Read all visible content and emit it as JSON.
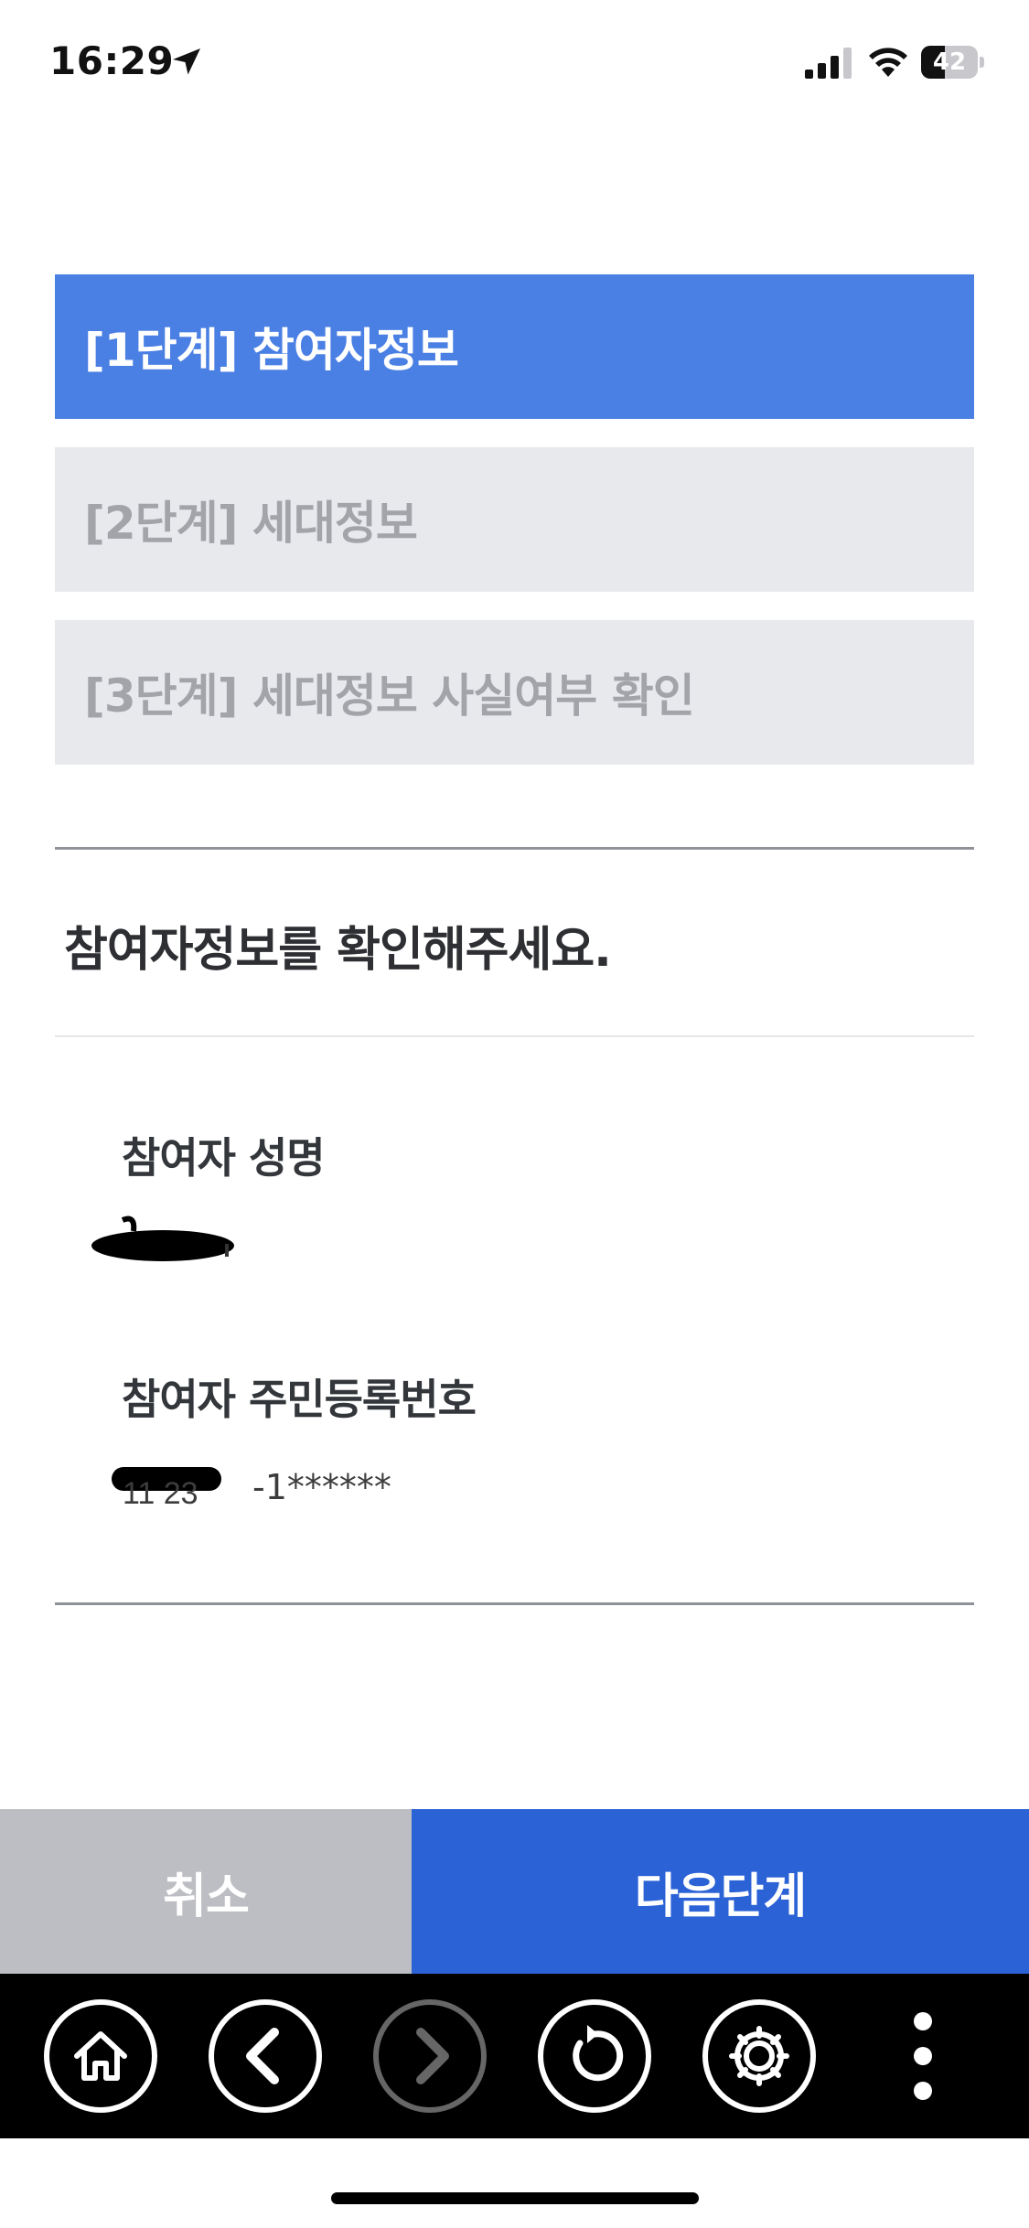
{
  "status_bar": {
    "time": "16:29",
    "battery_level": "42",
    "icons": [
      "location-arrow-icon",
      "cell-signal-icon",
      "wifi-icon",
      "battery-icon"
    ]
  },
  "steps": [
    {
      "label": "[1단계] 참여자정보",
      "active": true
    },
    {
      "label": "[2단계] 세대정보",
      "active": false
    },
    {
      "label": "[3단계] 세대정보 사실여부 확인",
      "active": false
    }
  ],
  "section": {
    "heading": "참여자정보를 확인해주세요."
  },
  "fields": {
    "name_label": "참여자 성명",
    "name_value": "",
    "rrn_label": "참여자 주민등록번호",
    "rrn_value": "-1******"
  },
  "buttons": {
    "cancel": "취소",
    "next": "다음단계"
  },
  "colors": {
    "active_step": "#4a7fe3",
    "inactive_step": "#e8e9ed",
    "next_button": "#2b62d6",
    "cancel_button": "#bcbec3"
  },
  "toolbar": {
    "icons": [
      "home-icon",
      "back-icon",
      "forward-icon",
      "refresh-icon",
      "settings-icon",
      "more-icon"
    ]
  }
}
